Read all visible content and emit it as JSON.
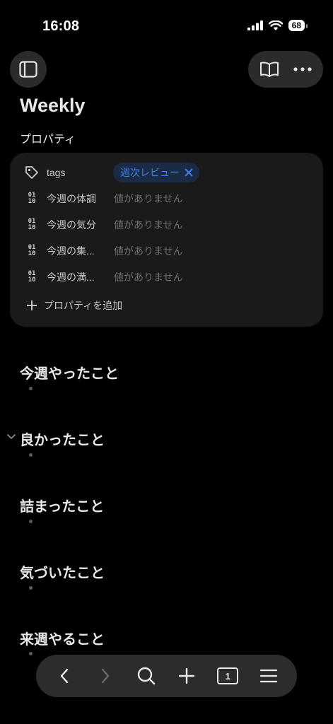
{
  "status_bar": {
    "time": "16:08",
    "battery": "68"
  },
  "page": {
    "title": "Weekly",
    "properties_heading": "プロパティ"
  },
  "properties": {
    "tags_label": "tags",
    "tag_value": "週次レビュー",
    "rows": [
      {
        "name": "今週の体調",
        "value": "値がありません"
      },
      {
        "name": "今週の気分",
        "value": "値がありません"
      },
      {
        "name": "今週の集...",
        "value": "値がありません"
      },
      {
        "name": "今週の満...",
        "value": "値がありません"
      }
    ],
    "add_property_label": "プロパティを追加",
    "number_icon_text": {
      "top": "01",
      "bottom": "10"
    }
  },
  "sections": [
    {
      "heading": "今週やったこと"
    },
    {
      "heading": "良かったこと"
    },
    {
      "heading": "詰まったこと"
    },
    {
      "heading": "気づいたこと"
    },
    {
      "heading": "来週やること"
    }
  ],
  "toolbar": {
    "tab_count": "1"
  }
}
